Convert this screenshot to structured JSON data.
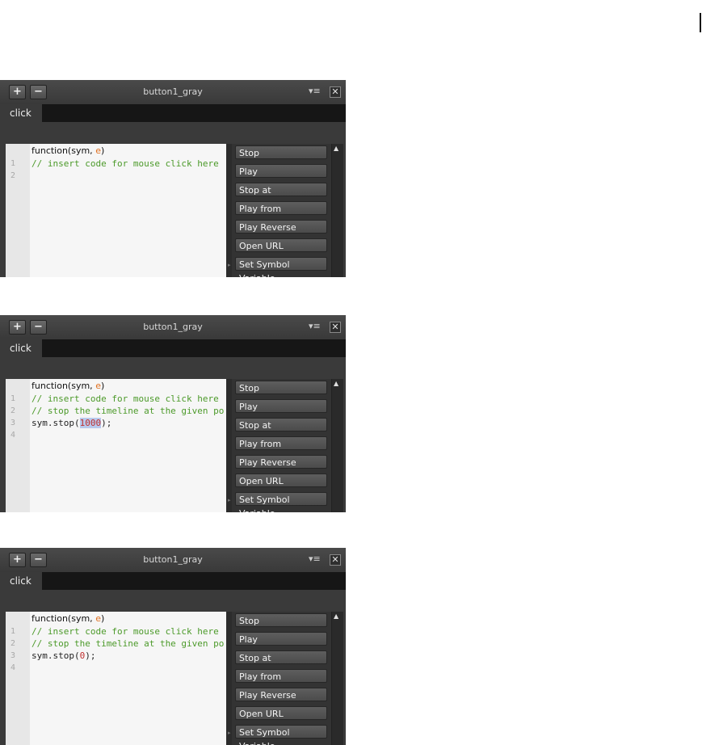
{
  "panels": [
    {
      "title": "button1_gray",
      "tab": "click",
      "header": "function(sym, ",
      "header_param": "e",
      "header_end": ")",
      "line_numbers": [
        "1",
        "2"
      ],
      "line1": "// insert code for mouse click here",
      "line2": "",
      "line3_prefix": "",
      "line3_arg": "",
      "line3_suffix": ""
    },
    {
      "title": "button1_gray",
      "tab": "click",
      "header": "function(sym, ",
      "header_param": "e",
      "header_end": ")",
      "line_numbers": [
        "1",
        "2",
        "3",
        "4"
      ],
      "line1": "// insert code for mouse click here",
      "line2": "// stop the timeline at the given po",
      "line3_prefix": "sym.stop(",
      "line3_arg": "1000",
      "line3_suffix": ");"
    },
    {
      "title": "button1_gray",
      "tab": "click",
      "header": "function(sym, ",
      "header_param": "e",
      "header_end": ")",
      "line_numbers": [
        "1",
        "2",
        "3",
        "4"
      ],
      "line1": "// insert code for mouse click here",
      "line2": "// stop the timeline at the given po",
      "line3_prefix": "sym.stop(",
      "line3_arg": "0",
      "line3_suffix": ");"
    }
  ],
  "actions": [
    "Stop",
    "Play",
    "Stop at",
    "Play from",
    "Play Reverse",
    "Open URL",
    "Set Symbol Variable"
  ],
  "icons": {
    "plus": "+",
    "minus": "−",
    "menu": "▾≡",
    "close": "✕",
    "scroll_up": "▲",
    "collapse": "▸"
  }
}
